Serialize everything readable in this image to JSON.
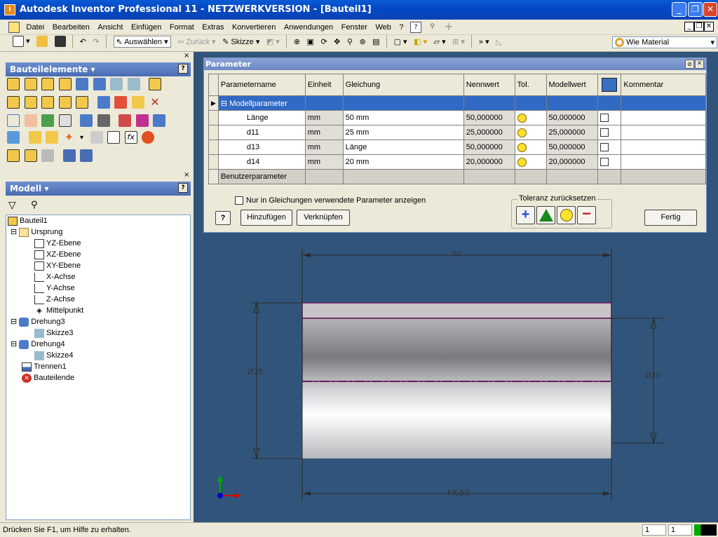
{
  "window": {
    "title": "Autodesk Inventor Professional 11 - NETZWERKVERSION - [Bauteil1]",
    "app_icon": "inventor-icon"
  },
  "menu": {
    "items": [
      "Datei",
      "Bearbeiten",
      "Ansicht",
      "Einfügen",
      "Format",
      "Extras",
      "Konvertieren",
      "Anwendungen",
      "Fenster",
      "Web",
      "?"
    ]
  },
  "toolbar": {
    "select_label": "Auswählen",
    "back_label": "Zurück",
    "sketch_label": "Skizze",
    "material_label": "Wie Material"
  },
  "panel_features": {
    "title": "Bauteilelemente ▾",
    "help": "?",
    "fx": "fx"
  },
  "panel_model": {
    "title": "Modell ▾",
    "help": "?"
  },
  "tree": {
    "root": "Bauteil1",
    "nodes": [
      "Ursprung",
      "YZ-Ebene",
      "XZ-Ebene",
      "XY-Ebene",
      "X-Achse",
      "Y-Achse",
      "Z-Achse",
      "Mittelpunkt",
      "Drehung3",
      "Skizze3",
      "Drehung4",
      "Skizze4",
      "Trennen1",
      "Bauteilende"
    ]
  },
  "dialog": {
    "title": "Parameter",
    "headers": {
      "name": "Parametername",
      "unit": "Einheit",
      "equation": "Gleichung",
      "nominal": "Nennwert",
      "tol": "Tol.",
      "model": "Modellwert",
      "comment": "Kommentar"
    },
    "group_model": "Modellparameter",
    "group_user": "Benutzerparameter",
    "rows": [
      {
        "name": "Länge",
        "unit": "mm",
        "equation": "50 mm",
        "nominal": "50,000000",
        "model": "50,000000"
      },
      {
        "name": "d11",
        "unit": "mm",
        "equation": "25 mm",
        "nominal": "25,000000",
        "model": "25,000000"
      },
      {
        "name": "d13",
        "unit": "mm",
        "equation": "Länge",
        "nominal": "50,000000",
        "model": "50,000000"
      },
      {
        "name": "d14",
        "unit": "mm",
        "equation": "20 mm",
        "nominal": "20,000000",
        "model": "20,000000"
      }
    ],
    "checkbox_label": "Nur in Gleichungen verwendete Parameter anzeigen",
    "tolerance_label": "Toleranz zurücksetzen",
    "add_button": "Hinzufügen",
    "link_button": "Verknüpfen",
    "done_button": "Fertig",
    "help": "?"
  },
  "drawing": {
    "dim_length": "50",
    "dim_outer": "Ø25",
    "dim_inner": "Ø20",
    "dim_bottom": "FX:50"
  },
  "status": {
    "text": "Drücken Sie F1, um Hilfe zu erhalten.",
    "field1": "1",
    "field2": "1"
  }
}
